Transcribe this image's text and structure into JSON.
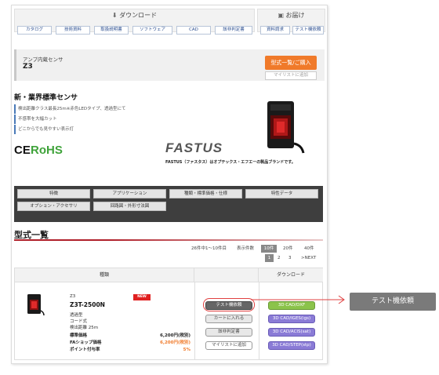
{
  "downloads": {
    "title": "ダウンロード",
    "tabs": [
      "カタログ",
      "技術資料",
      "取扱説明書",
      "ソフトウェア",
      "CAD",
      "該非判定書"
    ]
  },
  "shipping": {
    "title": "お届け",
    "tabs": [
      "資料請求",
      "テスト機依頼"
    ]
  },
  "product": {
    "subtitle": "アンプ内蔵センサ",
    "model": "Z3",
    "buy_label": "型式一覧/ご購入",
    "mylist_label": "マイリストに追加"
  },
  "headline": "新・業界標準センサ",
  "features": [
    "検出距離クラス最長25m※赤色LEDタイプ、透過型にて",
    "不感帯を大幅カット",
    "どこからでも見やすい表示灯"
  ],
  "logos": {
    "ce": "CE",
    "rohs": "RoHS",
    "fastus": "FASTUS",
    "fastus_note": "FASTUS（ファスタス）はオプテックス・エフエーの製品ブランドです。"
  },
  "categories": [
    "特徴",
    "アプリケーション",
    "種類・標準価格・仕様",
    "特性データ",
    "オプション・アクセサリ",
    "回路図・外形寸法図"
  ],
  "list": {
    "title": "型式一覧",
    "count_text": "26件中1～10件目",
    "per_page_label": "表示件数",
    "per_page_options": [
      "10件",
      "20件",
      "40件"
    ],
    "pages": [
      "1",
      "2",
      "3"
    ],
    "next_label": ">NEXT"
  },
  "table": {
    "col_type": "種類",
    "col_download": "ダウンロード",
    "row": {
      "series": "Z3",
      "badge": "NEW",
      "model": "Z3T-2500N",
      "specs": [
        "透過型",
        "コード式",
        "検出距離 25m"
      ],
      "price_label": "標準価格",
      "price": "6,200円(税別)",
      "fa_label": "FAショップ価格",
      "fa_price": "6,200円(税別)",
      "point_label": "ポイント付与率",
      "point": "5%"
    },
    "actions": [
      "テスト機依頼",
      "カートに入れる",
      "該非判定書",
      "マイリストに追加"
    ],
    "downloads": [
      "3D CAD/DXF",
      "3D CAD/IGES(igs)",
      "3D CAD/ACIS(sat)",
      "3D CAD/STEP(stp)"
    ]
  },
  "callout": "テスト機依頼",
  "colors": {
    "accent_orange": "#f07a2a",
    "title_red": "#b0202a",
    "highlight": "#e04040"
  }
}
